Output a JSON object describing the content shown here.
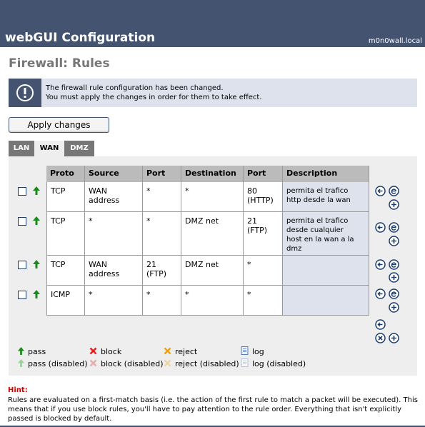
{
  "header": {
    "title": "webGUI Configuration",
    "hostname": "m0n0wall.local"
  },
  "page_title": "Firewall: Rules",
  "notice": {
    "line1": "The firewall rule configuration has been changed.",
    "line2": "You must apply the changes in order for them to take effect."
  },
  "apply_label": "Apply changes",
  "tabs": [
    {
      "label": "LAN",
      "active": false
    },
    {
      "label": "WAN",
      "active": true
    },
    {
      "label": "DMZ",
      "active": false
    }
  ],
  "table": {
    "headers": [
      "Proto",
      "Source",
      "Port",
      "Destination",
      "Port",
      "Description"
    ],
    "rows": [
      {
        "proto": "TCP",
        "source": "WAN address",
        "port": "*",
        "destination": "*",
        "dport": "80\n(HTTP)",
        "description": "permita el trafico\nhttp desde la wan"
      },
      {
        "proto": "TCP",
        "source": "*",
        "port": "*",
        "destination": "DMZ net",
        "dport": "21 (FTP)",
        "description": "permita el trafico\ndesde cualquier\nhost en la wan a la\ndmz"
      },
      {
        "proto": "TCP",
        "source": "WAN address",
        "port": "21 (FTP)",
        "destination": "DMZ net",
        "dport": "*",
        "description": ""
      },
      {
        "proto": "ICMP",
        "source": "*",
        "port": "*",
        "destination": "*",
        "dport": "*",
        "description": ""
      }
    ]
  },
  "legend": {
    "pass": "pass",
    "pass_disabled": "pass (disabled)",
    "block": "block",
    "block_disabled": "block (disabled)",
    "reject": "reject",
    "reject_disabled": "reject (disabled)",
    "log": "log",
    "log_disabled": "log (disabled)"
  },
  "hint": {
    "title": "Hint:",
    "text": "Rules are evaluated on a first-match basis (i.e. the action of the first rule to match a packet will be executed). This means that if you use block rules, you'll have to pay attention to the rule order. Everything that isn't explicitly passed is blocked by default."
  },
  "colors": {
    "header_bg": "#435370",
    "panel_bg": "#eeeeee",
    "desc_bg": "#dde2ec",
    "pass": "#1a8a1a",
    "block": "#e02020",
    "reject": "#e8a020",
    "hint": "#cc0000"
  }
}
